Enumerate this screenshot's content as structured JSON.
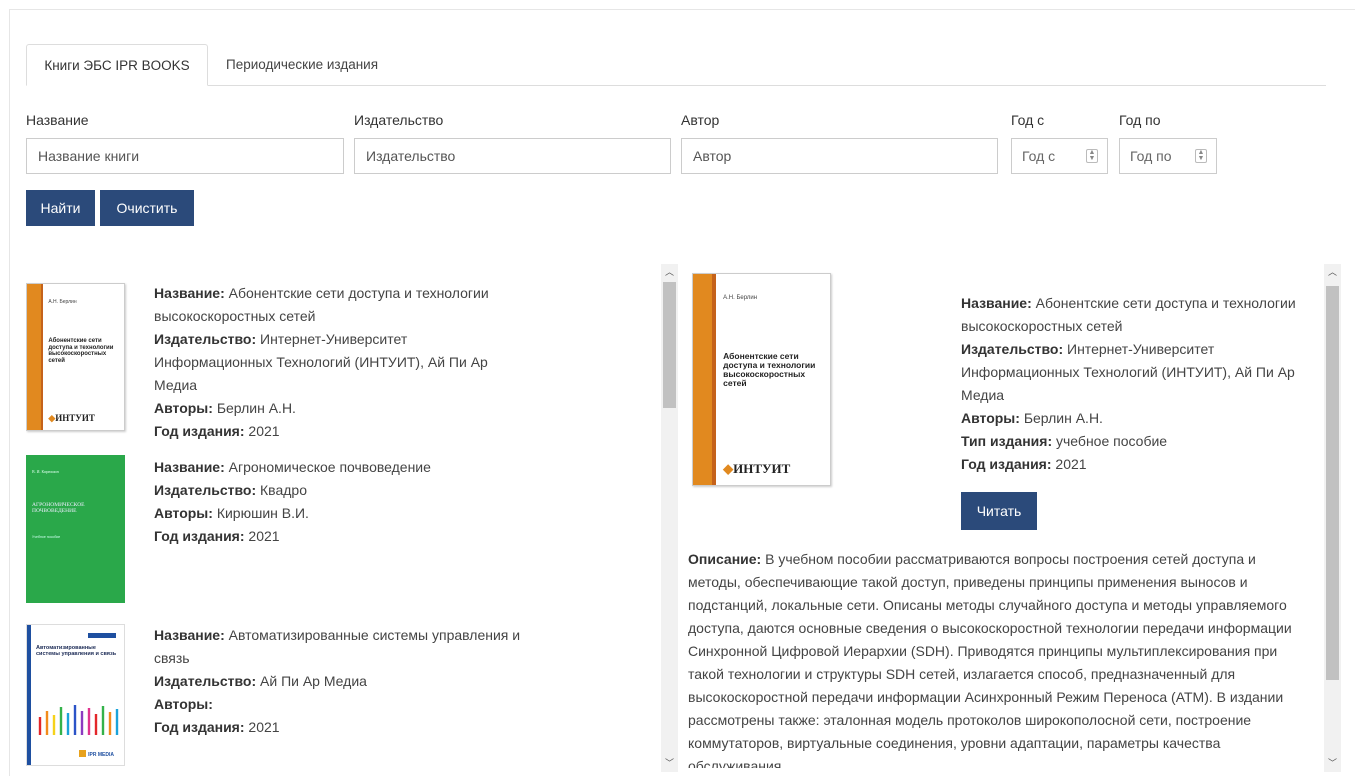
{
  "tabs": [
    {
      "label": "Книги ЭБС IPR BOOKS"
    },
    {
      "label": "Периодические издания"
    }
  ],
  "filters": {
    "title": {
      "label": "Название",
      "placeholder": "Название книги"
    },
    "publisher": {
      "label": "Издательство",
      "placeholder": "Издательство"
    },
    "author": {
      "label": "Автор",
      "placeholder": "Автор"
    },
    "year_from": {
      "label": "Год с",
      "placeholder": "Год с"
    },
    "year_to": {
      "label": "Год по",
      "placeholder": "Год по"
    }
  },
  "buttons": {
    "search": "Найти",
    "clear": "Очистить",
    "read": "Читать"
  },
  "field_labels": {
    "title": "Название:",
    "publisher": "Издательство:",
    "authors": "Авторы:",
    "year": "Год издания:",
    "type": "Тип издания:",
    "description": "Описание:"
  },
  "books": [
    {
      "title": "Абонентские сети доступа и технологии высокоскоростных сетей",
      "publisher": "Интернет-Университет Информационных Технологий (ИНТУИТ), Ай Пи Ар Медиа",
      "authors": "Берлин А.Н.",
      "year": "2021",
      "cover": {
        "author": "А.Н. Берлин",
        "title": "Абонентские сети доступа и технологии высокоскоростных сетей",
        "logo": "ИНТУИТ"
      }
    },
    {
      "title": "Агрономическое почвоведение",
      "publisher": "Квадро",
      "authors": "Кирюшин В.И.",
      "year": "2021",
      "cover": {
        "author": "В. И. Кирюшин",
        "title": "АГРОНОМИЧЕСКОЕ ПОЧВОВЕДЕНИЕ",
        "subtitle": "Учебное пособие"
      }
    },
    {
      "title": "Автоматизированные системы управления и связь",
      "publisher": "Ай Пи Ар Медиа",
      "authors": "",
      "year": "2021",
      "cover": {
        "title": "Автоматизированные системы управления и связь",
        "logo": "IPR MEDIA"
      }
    }
  ],
  "detail": {
    "title": "Абонентские сети доступа и технологии высокоскоростных сетей",
    "publisher": "Интернет-Университет Информационных Технологий (ИНТУИТ), Ай Пи Ар Медиа",
    "authors": "Берлин А.Н.",
    "type": "учебное пособие",
    "year": "2021",
    "cover": {
      "author": "А.Н. Берлин",
      "title": "Абонентские сети доступа и технологии высокоскоростных сетей",
      "logo": "ИНТУИТ"
    },
    "description": "В учебном пособии рассматриваются вопросы построения сетей доступа и методы, обеспечивающие такой доступ, приведены принципы применения выносов и подстанций, локальные сети. Описаны методы случайного доступа и методы управляемого доступа, даются основные сведения о высокоскоростной технологии передачи информации Синхронной Цифровой Иерархии (SDH). Приводятся принципы мультиплексирования при такой технологии и структуры SDH сетей, излагается способ, предназначенный для высокоскоростной передачи информации Асинхронный Режим Переноса (ATM). В издании рассмотрены также: эталонная модель протоколов широкополосной сети, построение коммутаторов, виртуальные соединения, уровни адаптации, параметры качества обслуживания"
  },
  "colors": {
    "primary_button": "#2b4a7a",
    "cover_orange": "#e1891f",
    "cover_green": "#2aa84a"
  },
  "icons": {
    "spinner": "spinner-arrows-icon",
    "scroll_up": "scroll-up-icon",
    "scroll_down": "scroll-down-icon"
  }
}
